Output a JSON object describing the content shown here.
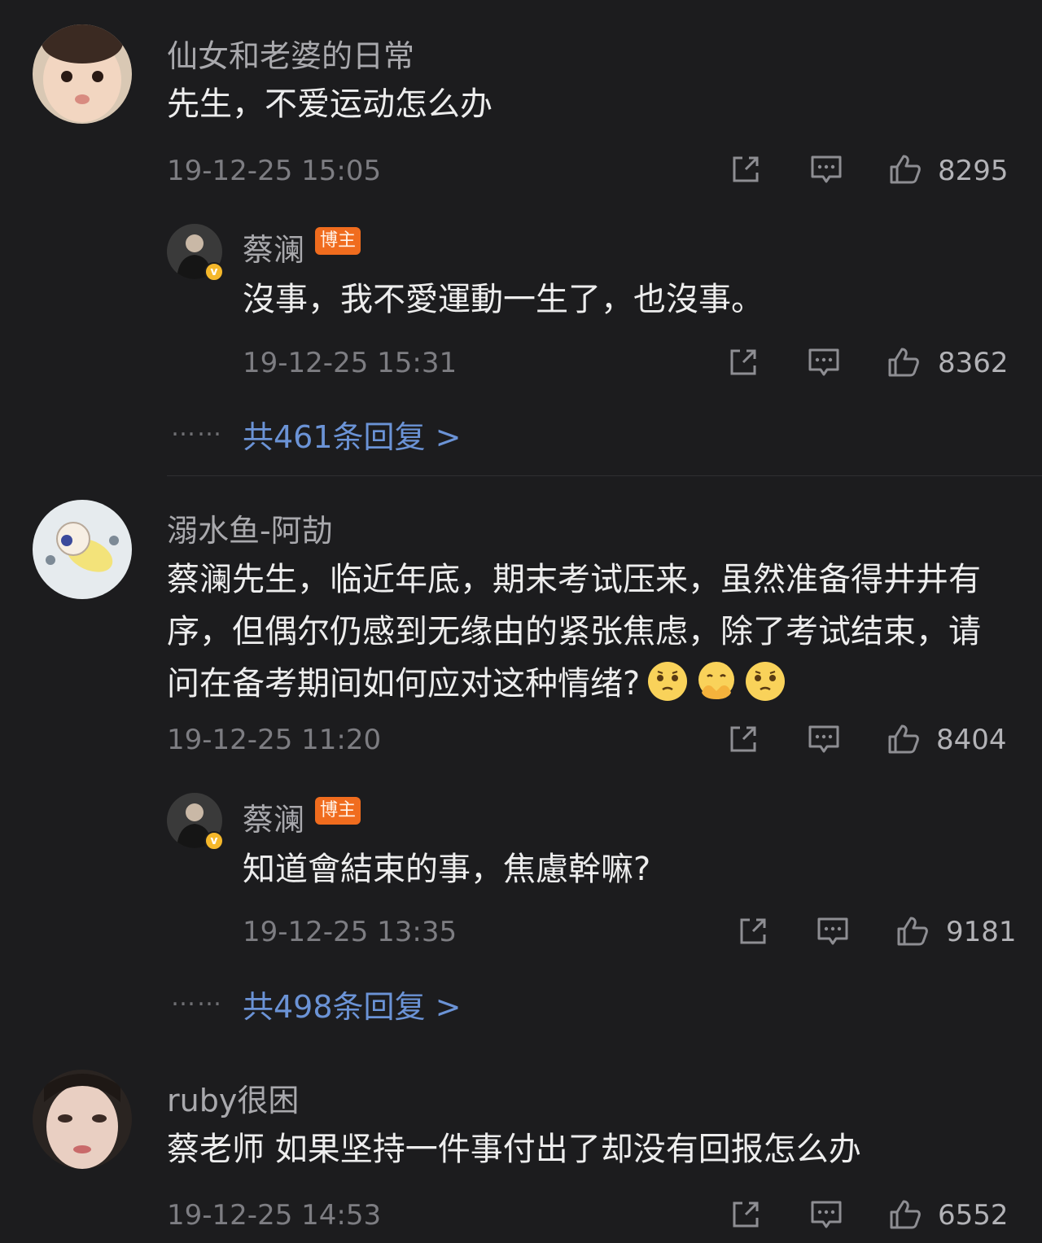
{
  "comments": [
    {
      "username": "仙女和老婆的日常",
      "text": "先生，不爱运动怎么办",
      "time": "19-12-25 15:05",
      "likes": "8295",
      "reply": {
        "username": "蔡澜",
        "badge": "博主",
        "text": "沒事，我不愛運動一生了，也沒事。",
        "time": "19-12-25 15:31",
        "likes": "8362"
      },
      "more_dots": "……",
      "more_replies": "共461条回复 >"
    },
    {
      "username": "溺水鱼-阿劼",
      "text": "蔡澜先生，临近年底，期末考试压来，虽然准备得井井有序，但偶尔仍感到无缘由的紧张焦虑，除了考试结束，请问在备考期间如何应对这种情绪?",
      "emojis": [
        "worried-face",
        "hands-over-mouth-face",
        "worried-face"
      ],
      "time": "19-12-25 11:20",
      "likes": "8404",
      "reply": {
        "username": "蔡澜",
        "badge": "博主",
        "text": "知道會結束的事，焦慮幹嘛?",
        "time": "19-12-25 13:35",
        "likes": "9181"
      },
      "more_dots": "……",
      "more_replies": "共498条回复 >"
    },
    {
      "username": "ruby很困",
      "text": "蔡老师 如果坚持一件事付出了却没有回报怎么办",
      "time": "19-12-25 14:53",
      "likes": "6552"
    }
  ],
  "colors": {
    "background": "#1c1c1e",
    "link": "#6b93d6",
    "badge": "#f06c1e"
  }
}
